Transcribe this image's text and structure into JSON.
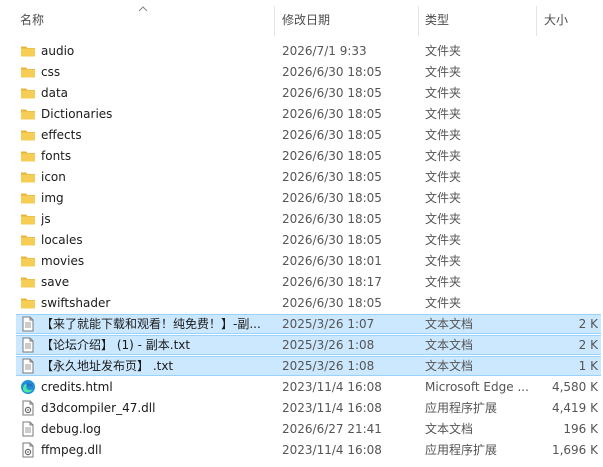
{
  "header": {
    "name": "名称",
    "date": "修改日期",
    "type": "类型",
    "size": "大小"
  },
  "colors": {
    "selection": "#cce8ff",
    "selection_border": "#99d1ff",
    "folder": "#f2c94c"
  },
  "rows": [
    {
      "name": "audio",
      "date": "2026/7/1 9:33",
      "type": "文件夹",
      "size": "",
      "icon": "folder-icon",
      "selected": false
    },
    {
      "name": "css",
      "date": "2026/6/30 18:05",
      "type": "文件夹",
      "size": "",
      "icon": "folder-icon",
      "selected": false
    },
    {
      "name": "data",
      "date": "2026/6/30 18:05",
      "type": "文件夹",
      "size": "",
      "icon": "folder-icon",
      "selected": false
    },
    {
      "name": "Dictionaries",
      "date": "2026/6/30 18:05",
      "type": "文件夹",
      "size": "",
      "icon": "folder-icon",
      "selected": false
    },
    {
      "name": "effects",
      "date": "2026/6/30 18:05",
      "type": "文件夹",
      "size": "",
      "icon": "folder-icon",
      "selected": false
    },
    {
      "name": "fonts",
      "date": "2026/6/30 18:05",
      "type": "文件夹",
      "size": "",
      "icon": "folder-icon",
      "selected": false
    },
    {
      "name": "icon",
      "date": "2026/6/30 18:05",
      "type": "文件夹",
      "size": "",
      "icon": "folder-icon",
      "selected": false
    },
    {
      "name": "img",
      "date": "2026/6/30 18:05",
      "type": "文件夹",
      "size": "",
      "icon": "folder-icon",
      "selected": false
    },
    {
      "name": "js",
      "date": "2026/6/30 18:05",
      "type": "文件夹",
      "size": "",
      "icon": "folder-icon",
      "selected": false
    },
    {
      "name": "locales",
      "date": "2026/6/30 18:05",
      "type": "文件夹",
      "size": "",
      "icon": "folder-icon",
      "selected": false
    },
    {
      "name": "movies",
      "date": "2026/6/30 18:01",
      "type": "文件夹",
      "size": "",
      "icon": "folder-icon",
      "selected": false
    },
    {
      "name": "save",
      "date": "2026/6/30 18:17",
      "type": "文件夹",
      "size": "",
      "icon": "folder-icon",
      "selected": false
    },
    {
      "name": "swiftshader",
      "date": "2026/6/30 18:05",
      "type": "文件夹",
      "size": "",
      "icon": "folder-icon",
      "selected": false
    },
    {
      "name": "【来了就能下载和观看！纯免费！】-副...",
      "date": "2025/3/26 1:07",
      "type": "文本文档",
      "size": "2 K",
      "icon": "text-file-icon",
      "selected": true
    },
    {
      "name": "【论坛介绍】 (1) - 副本.txt",
      "date": "2025/3/26 1:08",
      "type": "文本文档",
      "size": "2 K",
      "icon": "text-file-icon",
      "selected": true
    },
    {
      "name": "【永久地址发布页】 .txt",
      "date": "2025/3/26 1:08",
      "type": "文本文档",
      "size": "1 K",
      "icon": "text-file-icon",
      "selected": true
    },
    {
      "name": "credits.html",
      "date": "2023/11/4 16:08",
      "type": "Microsoft Edge ...",
      "size": "4,580 K",
      "icon": "edge-icon",
      "selected": false
    },
    {
      "name": "d3dcompiler_47.dll",
      "date": "2023/11/4 16:08",
      "type": "应用程序扩展",
      "size": "4,419 K",
      "icon": "dll-file-icon",
      "selected": false
    },
    {
      "name": "debug.log",
      "date": "2026/6/27 21:41",
      "type": "文本文档",
      "size": "196 K",
      "icon": "text-file-icon",
      "selected": false
    },
    {
      "name": "ffmpeg.dll",
      "date": "2023/11/4 16:08",
      "type": "应用程序扩展",
      "size": "1,696 K",
      "icon": "dll-file-icon",
      "selected": false
    }
  ]
}
